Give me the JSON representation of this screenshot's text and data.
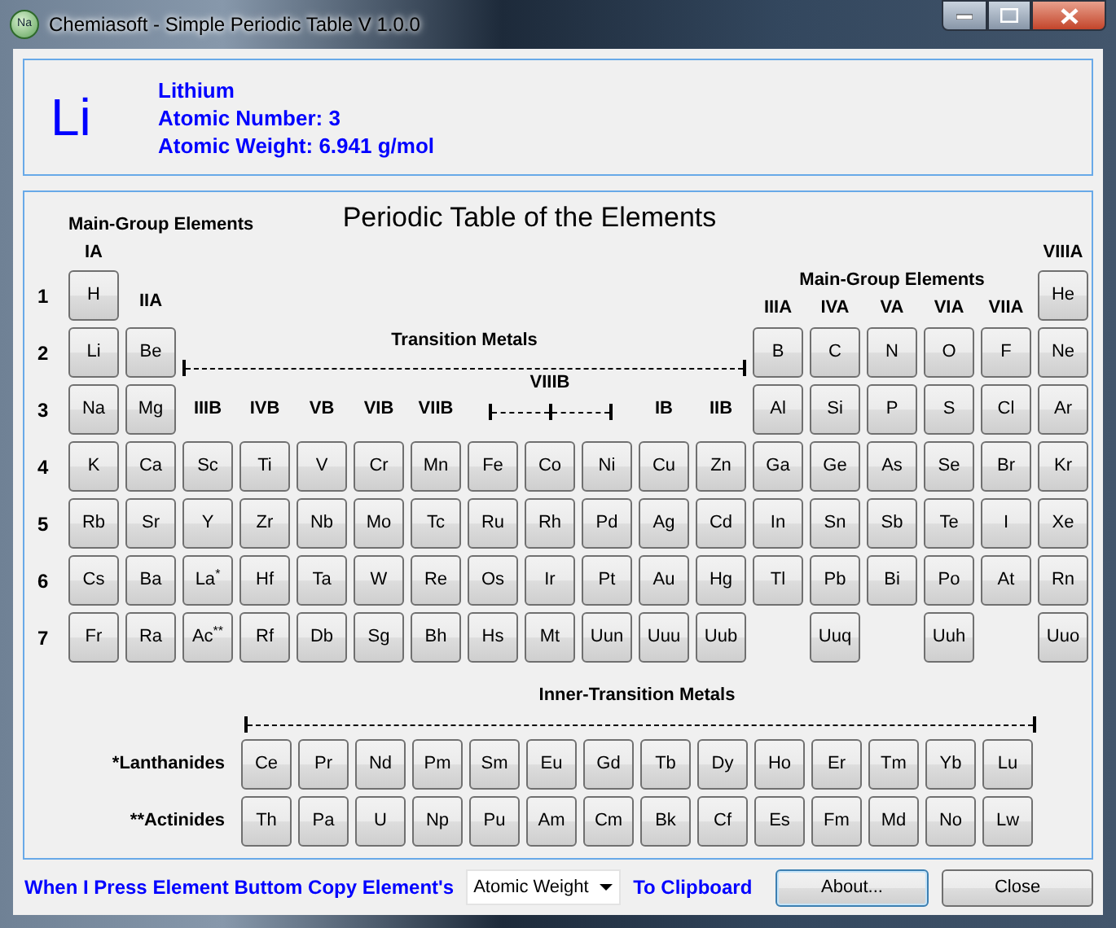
{
  "window": {
    "icon_text": "Na",
    "title": "Chemiasoft - Simple Periodic Table V 1.0.0"
  },
  "info": {
    "symbol": "Li",
    "name": "Lithium",
    "number": "Atomic Number: 3",
    "weight": "Atomic Weight: 6.941 g/mol"
  },
  "table": {
    "title": "Periodic Table of the Elements",
    "left_header": "Main-Group Elements",
    "right_header": "Main-Group Elements",
    "transition_header": "Transition Metals",
    "viiib_header": "VIIIB",
    "group_labels": [
      "IA",
      "VIIIA",
      "IIA",
      "IIIA",
      "IVA",
      "VA",
      "VIA",
      "VIIA",
      "IIIB",
      "IVB",
      "VB",
      "VIB",
      "VIIB",
      "IB",
      "IIB"
    ],
    "periods": [
      {
        "label": "1",
        "cells": [
          "H",
          null,
          null,
          null,
          null,
          null,
          null,
          null,
          null,
          null,
          null,
          null,
          null,
          null,
          null,
          null,
          null,
          "He"
        ]
      },
      {
        "label": "2",
        "cells": [
          "Li",
          "Be",
          null,
          null,
          null,
          null,
          null,
          null,
          null,
          null,
          null,
          null,
          "B",
          "C",
          "N",
          "O",
          "F",
          "Ne"
        ]
      },
      {
        "label": "3",
        "cells": [
          "Na",
          "Mg",
          null,
          null,
          null,
          null,
          null,
          null,
          null,
          null,
          null,
          null,
          "Al",
          "Si",
          "P",
          "S",
          "Cl",
          "Ar"
        ]
      },
      {
        "label": "4",
        "cells": [
          "K",
          "Ca",
          "Sc",
          "Ti",
          "V",
          "Cr",
          "Mn",
          "Fe",
          "Co",
          "Ni",
          "Cu",
          "Zn",
          "Ga",
          "Ge",
          "As",
          "Se",
          "Br",
          "Kr"
        ]
      },
      {
        "label": "5",
        "cells": [
          "Rb",
          "Sr",
          "Y",
          "Zr",
          "Nb",
          "Mo",
          "Tc",
          "Ru",
          "Rh",
          "Pd",
          "Ag",
          "Cd",
          "In",
          "Sn",
          "Sb",
          "Te",
          "I",
          "Xe"
        ]
      },
      {
        "label": "6",
        "cells": [
          "Cs",
          "Ba",
          "La$^{*}$",
          "Hf",
          "Ta",
          "W",
          "Re",
          "Os",
          "Ir",
          "Pt",
          "Au",
          "Hg",
          "Tl",
          "Pb",
          "Bi",
          "Po",
          "At",
          "Rn"
        ]
      },
      {
        "label": "7",
        "cells": [
          "Fr",
          "Ra",
          "Ac$^{**}$",
          "Rf",
          "Db",
          "Sg",
          "Bh",
          "Hs",
          "Mt",
          "Uun",
          "Uuu",
          "Uub",
          null,
          "Uuq",
          null,
          "Uuh",
          null,
          "Uuo"
        ]
      }
    ]
  },
  "inner_transition": {
    "title": "Inner-Transition Metals",
    "series": [
      {
        "label": "*Lanthanides",
        "elements": [
          "Ce",
          "Pr",
          "Nd",
          "Pm",
          "Sm",
          "Eu",
          "Gd",
          "Tb",
          "Dy",
          "Ho",
          "Er",
          "Tm",
          "Yb",
          "Lu"
        ]
      },
      {
        "label": "**Actinides",
        "elements": [
          "Th",
          "Pa",
          "U",
          "Np",
          "Pu",
          "Am",
          "Cm",
          "Bk",
          "Cf",
          "Es",
          "Fm",
          "Md",
          "No",
          "Lw"
        ]
      }
    ]
  },
  "footer": {
    "prompt": "When I Press Element Buttom Copy Element's",
    "dropdown": "Atomic Weight",
    "suffix": "To Clipboard",
    "buttons": [
      {
        "label": "About...",
        "focused": true
      },
      {
        "label": "Close",
        "focused": false
      }
    ]
  }
}
